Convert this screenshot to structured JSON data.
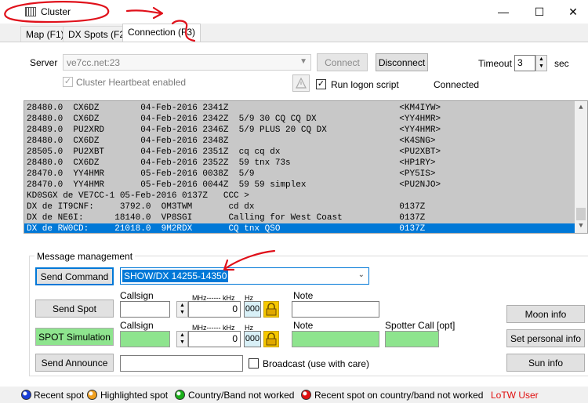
{
  "window": {
    "title": "Cluster",
    "minimize": "—",
    "maximize": "☐",
    "close": "✕"
  },
  "tabs": [
    {
      "label": "Map (F1)"
    },
    {
      "label": "DX Spots (F2)"
    },
    {
      "label": "Connection (F3)"
    }
  ],
  "connection": {
    "server_label": "Server",
    "server_value": "ve7cc.net:23",
    "connect_label": "Connect",
    "disconnect_label": "Disconnect",
    "timeout_label": "Timeout",
    "timeout_value": "3",
    "timeout_unit": "sec",
    "heartbeat_label": "Cluster Heartbeat enabled",
    "heartbeat_checked": "✓",
    "logon_label": "Run logon script",
    "logon_checked": "✓",
    "status": "Connected"
  },
  "log_lines": [
    "28480.0  CX6DZ        04-Feb-2016 2341Z                                 <KM4IYW>",
    "28480.0  CX6DZ        04-Feb-2016 2342Z  5/9 30 CQ CQ DX                <YY4HMR>",
    "28489.0  PU2XRD       04-Feb-2016 2346Z  5/9 PLUS 20 CQ DX              <YY4HMR>",
    "28480.0  CX6DZ        04-Feb-2016 2348Z                                 <K4SNG>",
    "28505.0  PU2XBT       04-Feb-2016 2351Z  cq cq dx                       <PU2XBT>",
    "28480.0  CX6DZ        04-Feb-2016 2352Z  59 tnx 73s                     <HP1RY>",
    "28470.0  YY4HMR       05-Feb-2016 0038Z  5/9                            <PY5IS>",
    "28470.0  YY4HMR       05-Feb-2016 0044Z  59 59 simplex                  <PU2NJO>",
    "KD0SGX de VE7CC-1 05-Feb-2016 0137Z   CCC >",
    "DX de IT9CNF:     3792.0  OM3TWM       cd dx                            0137Z",
    "DX de NE6I:      18140.0  VP8SGI       Calling for West Coast           0137Z",
    "DX de RW0CD:     21018.0  9M2RDX       CQ tnx QSO                       0137Z"
  ],
  "selected_line_index": 11,
  "message": {
    "group_title": "Message management",
    "send_command_label": "Send Command",
    "command_value": "SHOW/DX 14255-14350",
    "send_spot_label": "Send Spot",
    "spot_sim_label": "SPOT Simulation",
    "send_announce_label": "Send Announce",
    "callsign_label": "Callsign",
    "callsign_label2": "Callsign",
    "mhz_label": "MHz------ kHz",
    "mhz_label2": "MHz------ kHz",
    "hz_label": "Hz",
    "hz_label2": "Hz",
    "freq_value": "0",
    "freq_value2": "0",
    "hz_value": "000",
    "hz_value2": "000",
    "note_label": "Note",
    "note_label2": "Note",
    "spotter_label": "Spotter Call [opt]",
    "broadcast_label": "Broadcast (use with care)",
    "moon_label": "Moon info",
    "personal_label": "Set personal info",
    "sun_label": "Sun info"
  },
  "legend": [
    {
      "label": "Recent spot",
      "color": "#1a3fd9"
    },
    {
      "label": "Highlighted spot",
      "color": "#f0a020"
    },
    {
      "label": "Country/Band not worked",
      "color": "#19b019"
    },
    {
      "label": "Recent spot on country/band not worked",
      "color": "#e01010"
    }
  ],
  "lotw_label": "LoTW User",
  "lotw_color": "#e01010"
}
